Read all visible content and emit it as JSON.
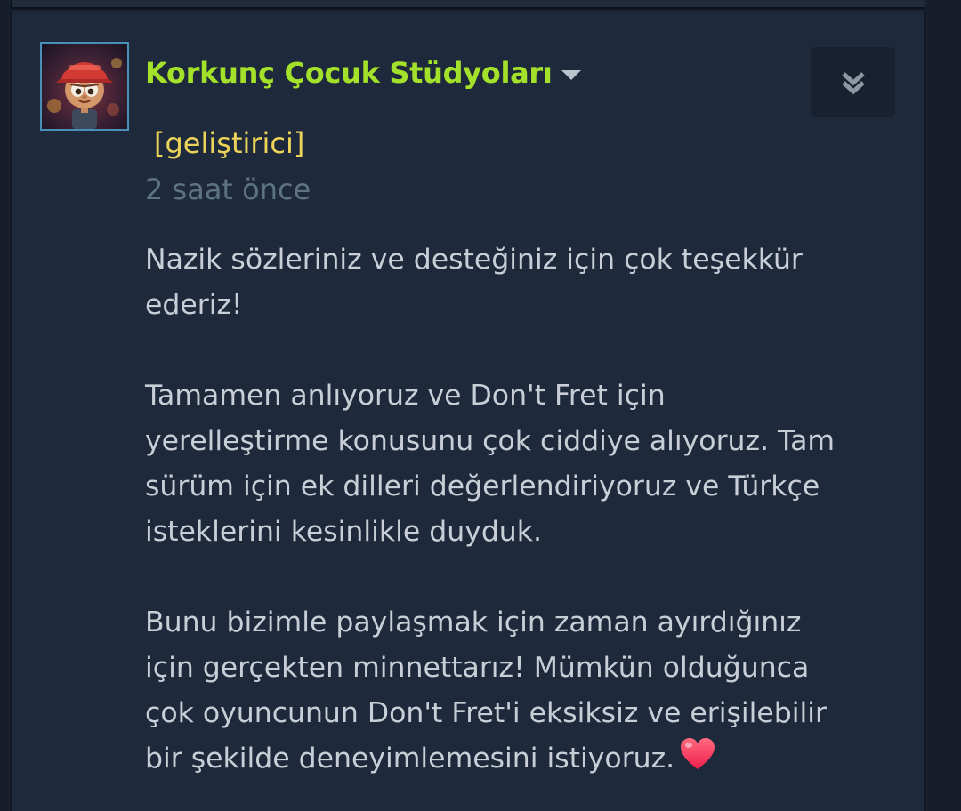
{
  "comment": {
    "author": "Korkunç Çocuk Stüdyoları",
    "badge": "[geliştirici]",
    "timestamp": "2 saat önce",
    "paragraphs": [
      "Nazik sözleriniz ve desteğiniz için çok teşekkür\nederiz!",
      "Tamamen anlıyoruz ve Don't Fret için\nyerelleştirme konusunu çok ciddiye alıyoruz. Tam\nsürüm için ek dilleri değerlendiriyoruz ve Türkçe\nisteklerini kesinlikle duyduk.",
      "Bunu bizimle paylaşmak için zaman ayırdığınız\niçin gerçekten minnettarız! Mümkün olduğunca\nçok oyuncunun Don't Fret'i eksiksiz ve erişilebilir\nbir şekilde deneyimlemesini istiyoruz."
    ],
    "icons": {
      "author_menu": "chevron-down-icon",
      "collapse": "double-chevron-down-icon",
      "emoji": "heart-icon"
    }
  },
  "colors": {
    "background": "#1e293c",
    "author_name": "#a4e12a",
    "badge": "#ecd45a",
    "timestamp": "#5d7283",
    "body_text": "#c7ced6",
    "avatar_border": "#4a8fb8",
    "heart": "#ff3a5c"
  }
}
